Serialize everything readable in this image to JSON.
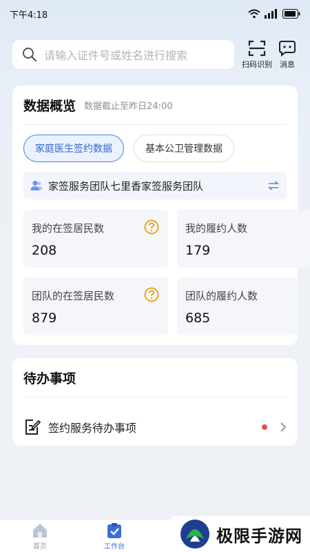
{
  "status_bar": {
    "time": "下午4:18"
  },
  "search": {
    "placeholder": "请输入证件号或姓名进行搜索"
  },
  "top_actions": {
    "scan_label": "扫码识别",
    "message_label": "消息"
  },
  "overview": {
    "title": "数据概览",
    "subtitle": "数据截止至昨日24:00",
    "tabs": [
      {
        "label": "家庭医生签约数据",
        "active": true
      },
      {
        "label": "基本公卫管理数据",
        "active": false
      }
    ],
    "team": "家签服务团队七里香家签服务团队",
    "stats": [
      {
        "label": "我的在签居民数",
        "value": "208"
      },
      {
        "label": "我的履约人数",
        "value": "179"
      },
      {
        "label": "团队的在签居民数",
        "value": "879"
      },
      {
        "label": "团队的履约人数",
        "value": "685"
      }
    ]
  },
  "todo": {
    "title": "待办事项",
    "item_label": "签约服务待办事项"
  },
  "tabbar": {
    "items": [
      {
        "label": "首页"
      },
      {
        "label": "工作台"
      }
    ]
  },
  "watermark": {
    "text": "极限手游网"
  },
  "colors": {
    "accent": "#3a6fd8",
    "warning": "#e6a817",
    "badge": "#ea4f4f"
  }
}
